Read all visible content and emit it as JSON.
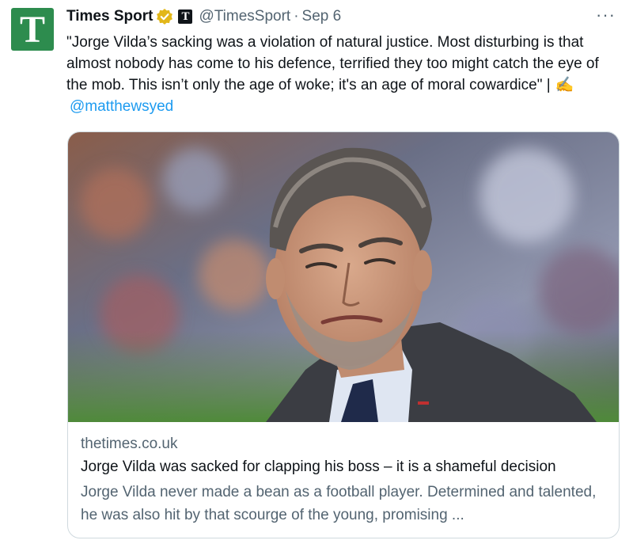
{
  "author": {
    "avatar_letter": "T",
    "avatar_color": "#2d8c4e",
    "display_name": "Times Sport",
    "affiliate_letter": "T",
    "handle": "@TimesSport",
    "separator": "·",
    "date": "Sep 6",
    "verified_color": "#e2b719"
  },
  "more_label": "···",
  "tweet": {
    "text": "\"Jorge Vilda’s sacking was a violation of natural justice. Most disturbing is that almost nobody has come to his defence, terrified they too might catch the eye of the mob. This isn’t only the age of woke; it's an age of moral cowardice\" |",
    "pen_emoji": "✍️",
    "mention": "@matthewsyed",
    "mention_color": "#1d9bf0"
  },
  "card": {
    "image_icon": "photo-of-man-in-suit",
    "domain": "thetimes.co.uk",
    "title": "Jorge Vilda was sacked for clapping his boss – it is a shameful decision",
    "description": "Jorge Vilda never made a bean as a football player. Determined and talented, he was also hit by that scourge of the young, promising ..."
  }
}
